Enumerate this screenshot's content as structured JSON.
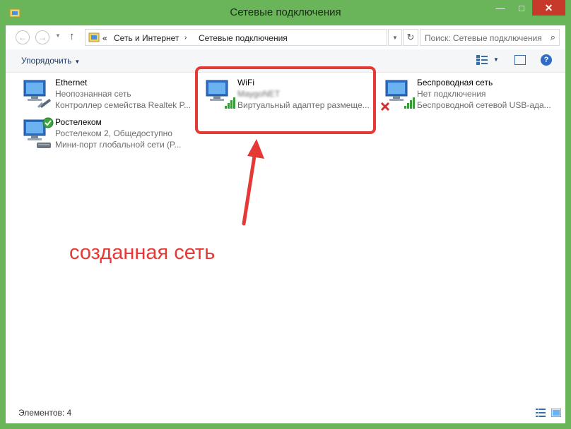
{
  "window": {
    "title": "Сетевые подключения",
    "controls": {
      "minimize": "—",
      "maximize": "□",
      "close": "✕"
    }
  },
  "address": {
    "chevrons": "«",
    "crumbs": [
      "Сеть и Интернет",
      "Сетевые подключения"
    ],
    "separator": "›",
    "search_placeholder": "Поиск: Сетевые подключения"
  },
  "toolbar": {
    "organize_label": "Упорядочить"
  },
  "connections": [
    {
      "name": "Ethernet",
      "status": "Неопознанная сеть",
      "device": "Контроллер семейства Realtek P...",
      "icon": "wired-network-icon"
    },
    {
      "name": "Ростелеком",
      "status": "Ростелеком  2, Общедоступно",
      "device": "Мини-порт глобальной сети (P...",
      "icon": "broadband-connected-icon"
    },
    {
      "name": "WiFi",
      "status": "MaygoNET",
      "device": "Виртуальный адаптер размеще...",
      "icon": "wifi-signal-icon"
    },
    {
      "name": "Беспроводная сеть",
      "status": "Нет подключения",
      "device": "Беспроводной сетевой USB-ада...",
      "icon": "wifi-disconnected-icon"
    }
  ],
  "annotation": {
    "text": "созданная сеть",
    "color": "#e53935"
  },
  "status": {
    "items_count": "Элементов: 4"
  },
  "colors": {
    "titlebar": "#6ab55a",
    "close": "#c7392b",
    "link": "#1f3b66"
  }
}
